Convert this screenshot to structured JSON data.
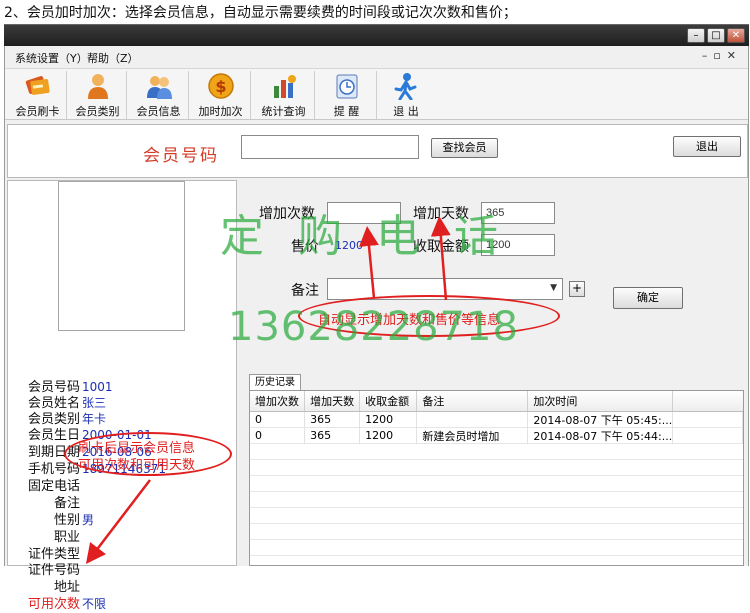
{
  "caption": "2、会员加时加次：选择会员信息，自动显示需要续费的时间段或记次次数和售价；",
  "menu": {
    "items": [
      "系统设置（Y）",
      "帮助（Z）"
    ]
  },
  "toolbar": {
    "items": [
      {
        "label": "会员刷卡",
        "icon": "card-icon"
      },
      {
        "label": "会员类别",
        "icon": "person-icon"
      },
      {
        "label": "会员信息",
        "icon": "people-icon"
      },
      {
        "label": "加时加次",
        "icon": "dollar-icon"
      },
      {
        "label": "统计查询",
        "icon": "chart-icon"
      },
      {
        "label": "提  醒",
        "icon": "reminder-icon"
      },
      {
        "label": "退  出",
        "icon": "exit-icon"
      }
    ]
  },
  "search": {
    "label": "会员号码",
    "value": "",
    "find_button": "查找会员",
    "exit_button": "退出"
  },
  "member": {
    "rows": [
      {
        "label": "会员号码",
        "value": "1001"
      },
      {
        "label": "会员姓名",
        "value": "张三"
      },
      {
        "label": "会员类别",
        "value": "年卡"
      },
      {
        "label": "会员生日",
        "value": "2000-01-01"
      },
      {
        "label": "到期日期",
        "value": "2016-08-06"
      },
      {
        "label": "手机号码",
        "value": "18971146371"
      },
      {
        "label": "固定电话",
        "value": ""
      },
      {
        "label": "备注",
        "value": ""
      },
      {
        "label": "性别",
        "value": "男"
      },
      {
        "label": "职业",
        "value": ""
      },
      {
        "label": "证件类型",
        "value": ""
      },
      {
        "label": "证件号码",
        "value": ""
      },
      {
        "label": "地址",
        "value": ""
      },
      {
        "label": "可用次数",
        "value": "不限"
      }
    ]
  },
  "form": {
    "add_count_label": "增加次数",
    "add_count_value": "",
    "add_days_label": "增加天数",
    "add_days_value": "365",
    "price_label": "售价",
    "price_value": "1200",
    "amount_label": "收取金额",
    "amount_value": "1200",
    "remark_label": "备注",
    "remark_value": "",
    "confirm_button": "确定",
    "plus_button": "+"
  },
  "history": {
    "tab": "历史记录",
    "columns": [
      "增加次数",
      "增加天数",
      "收取金额",
      "备注",
      "加次时间"
    ],
    "rows": [
      [
        "0",
        "365",
        "1200",
        "",
        "2014-08-07 下午 05:45:..."
      ],
      [
        "0",
        "365",
        "1200",
        "新建会员时增加",
        "2014-08-07 下午 05:44:..."
      ]
    ]
  },
  "annotations": {
    "top_note": "自动显示增加天数和售价等信息",
    "left_note_line1": "刷卡后显示会员信息",
    "left_note_line2": "可用次数和可用天数",
    "color": "#e02020"
  },
  "watermark": {
    "line1": "定购电话",
    "line2": "13628228718",
    "color": "#28aa3c"
  }
}
